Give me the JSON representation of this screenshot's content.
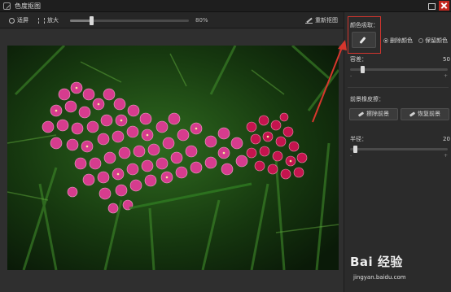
{
  "window": {
    "title": "色度抠图"
  },
  "toolbar": {
    "fit_label": "适屏",
    "zoom_label": "放大",
    "zoom_percent": 80,
    "zoom_value_text": "80%",
    "redraw_label": "重新抠图"
  },
  "panel": {
    "color_pick_label": "颜色吸取：",
    "remove_color_label": "删除颜色",
    "keep_color_label": "保留颜色",
    "selected_mode": "remove",
    "tolerance": {
      "label": "容差：",
      "value": 50,
      "value_text": "50",
      "min_text": "-",
      "max_text": "+"
    },
    "foreground_label": "前景橡皮擦：",
    "erase_fg_label": "擦除前景",
    "restore_fg_label": "恢复前景",
    "radius": {
      "label": "半径：",
      "value": 20,
      "value_text": "20",
      "min_text": "-",
      "max_text": "+"
    }
  },
  "watermark": {
    "logo_text": "Bai 经验",
    "url_text": "jingyan.baidu.com"
  },
  "colors": {
    "highlight": "#d2352e",
    "arrow": "#d8362d",
    "close_button": "#c2261e",
    "flower": "#d63c8e"
  }
}
